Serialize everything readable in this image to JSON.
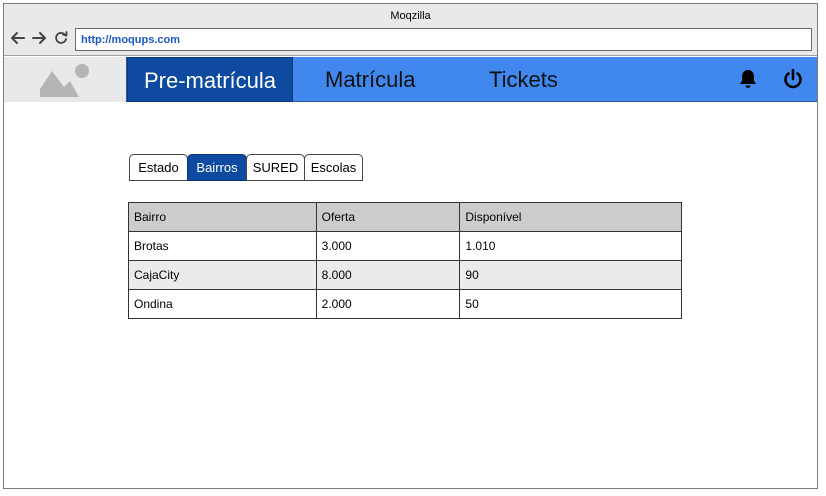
{
  "browser": {
    "title": "Moqzilla",
    "url": "http://moqups.com",
    "icons": [
      "back-arrow-icon",
      "forward-arrow-icon",
      "reload-icon"
    ]
  },
  "appnav": {
    "logo_icon": "image-placeholder-icon",
    "items": [
      {
        "label": "Pre-matrícula",
        "active": true
      },
      {
        "label": "Matrícula",
        "active": false
      },
      {
        "label": "Tickets",
        "active": false
      }
    ],
    "icons": [
      "bell-icon",
      "power-icon"
    ]
  },
  "tabs": [
    {
      "label": "Estado",
      "active": false
    },
    {
      "label": "Bairros",
      "active": true
    },
    {
      "label": "SURED",
      "active": false
    },
    {
      "label": "Escolas",
      "active": false
    }
  ],
  "table": {
    "headers": [
      "Bairro",
      "Oferta",
      "Disponível"
    ],
    "rows": [
      [
        "Brotas",
        "3.000",
        "1.010"
      ],
      [
        "CajaCity",
        "8.000",
        "90"
      ],
      [
        "Ondina",
        "2.000",
        "50"
      ]
    ]
  },
  "colors": {
    "nav_bar": "#4088ee",
    "nav_active": "#0d4aa0",
    "header_bg": "#cccccc",
    "alt_row_bg": "#ebebeb",
    "url_text": "#1a57c7"
  }
}
